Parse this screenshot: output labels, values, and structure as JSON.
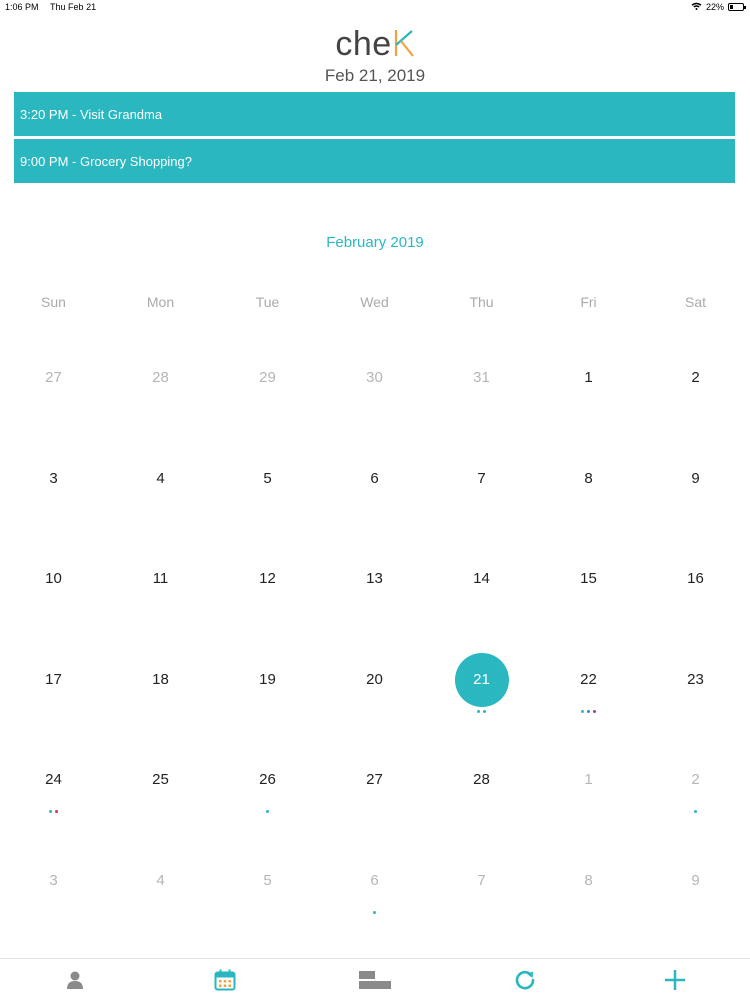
{
  "status_bar": {
    "time": "1:06 PM",
    "date": "Thu Feb 21",
    "battery": "22%"
  },
  "header": {
    "logo_text": "che",
    "selected_date": "Feb 21, 2019"
  },
  "events": [
    {
      "label": "3:20 PM - Visit Grandma"
    },
    {
      "label": "9:00 PM - Grocery Shopping?"
    }
  ],
  "calendar": {
    "month_title": "February 2019",
    "weekdays": [
      "Sun",
      "Mon",
      "Tue",
      "Wed",
      "Thu",
      "Fri",
      "Sat"
    ],
    "weeks": [
      [
        {
          "day": "27",
          "muted": true
        },
        {
          "day": "28",
          "muted": true
        },
        {
          "day": "29",
          "muted": true
        },
        {
          "day": "30",
          "muted": true
        },
        {
          "day": "31",
          "muted": true
        },
        {
          "day": "1"
        },
        {
          "day": "2"
        }
      ],
      [
        {
          "day": "3"
        },
        {
          "day": "4"
        },
        {
          "day": "5"
        },
        {
          "day": "6"
        },
        {
          "day": "7"
        },
        {
          "day": "8"
        },
        {
          "day": "9"
        }
      ],
      [
        {
          "day": "10"
        },
        {
          "day": "11"
        },
        {
          "day": "12"
        },
        {
          "day": "13"
        },
        {
          "day": "14"
        },
        {
          "day": "15"
        },
        {
          "day": "16"
        }
      ],
      [
        {
          "day": "17"
        },
        {
          "day": "18"
        },
        {
          "day": "19"
        },
        {
          "day": "20"
        },
        {
          "day": "21",
          "selected": true,
          "dots": [
            "#2ab7c0",
            "#2ab7c0"
          ]
        },
        {
          "day": "22",
          "dots": [
            "#2ab7c0",
            "#3f82e0",
            "#8e44ad"
          ]
        },
        {
          "day": "23"
        }
      ],
      [
        {
          "day": "24",
          "dots": [
            "#2ab7c0",
            "#e0344a"
          ]
        },
        {
          "day": "25"
        },
        {
          "day": "26",
          "dots": [
            "#2ab7c0"
          ]
        },
        {
          "day": "27"
        },
        {
          "day": "28"
        },
        {
          "day": "1",
          "muted": true
        },
        {
          "day": "2",
          "muted": true,
          "dots": [
            "#2ab7c0"
          ]
        }
      ],
      [
        {
          "day": "3",
          "muted": true
        },
        {
          "day": "4",
          "muted": true
        },
        {
          "day": "5",
          "muted": true
        },
        {
          "day": "6",
          "muted": true,
          "dots": [
            "#2ab7c0"
          ]
        },
        {
          "day": "7",
          "muted": true
        },
        {
          "day": "8",
          "muted": true
        },
        {
          "day": "9",
          "muted": true
        }
      ]
    ]
  },
  "tab_bar": {
    "tabs": [
      {
        "icon": "person-icon",
        "active": false
      },
      {
        "icon": "calendar-icon",
        "active": true
      },
      {
        "icon": "list-icon",
        "active": false
      },
      {
        "icon": "refresh-icon",
        "active": false
      },
      {
        "icon": "plus-icon",
        "active": false
      }
    ]
  },
  "colors": {
    "accent": "#2ab7c0",
    "logo_k_orange": "#f0a33a",
    "logo_k_teal": "#2ab7c0",
    "muted_text": "#b5b5b5",
    "icon_gray": "#8a8a8a"
  }
}
